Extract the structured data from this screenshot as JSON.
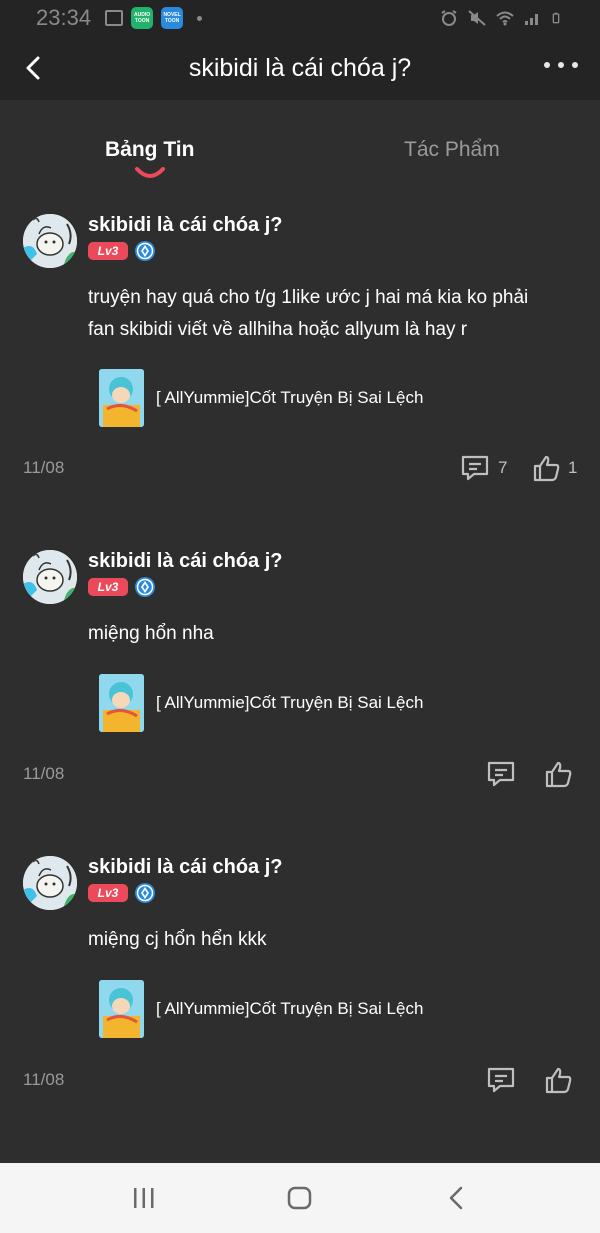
{
  "status_bar": {
    "time": "23:34",
    "app1": "AUDIO TOON",
    "app2": "NOVEL TOON"
  },
  "header": {
    "title": "skibidi là cái chóa j?"
  },
  "tabs": [
    {
      "label": "Bảng Tin",
      "active": true
    },
    {
      "label": "Tác Phẩm",
      "active": false
    }
  ],
  "colors": {
    "accent": "#ec4a5b",
    "background": "#2e2e2e",
    "header_bg": "#242424",
    "verify_blue": "#2a8ae0"
  },
  "posts": [
    {
      "author": "skibidi là cái chóa j?",
      "level": "Lv3",
      "text_lines": [
        "truyện hay quá cho t/g 1like ước j hai má kia ko phải",
        "fan skibidi viết về allhiha hoặc allyum là hay r"
      ],
      "work_title": "[ AllYummie]Cốt Truyện Bị Sai Lệch",
      "date": "11/08",
      "comment_count": "7",
      "like_count": "1"
    },
    {
      "author": "skibidi là cái chóa j?",
      "level": "Lv3",
      "text_lines": [
        "miệng hổn nha"
      ],
      "work_title": "[ AllYummie]Cốt Truyện Bị Sai Lệch",
      "date": "11/08",
      "comment_count": "",
      "like_count": ""
    },
    {
      "author": "skibidi là cái chóa j?",
      "level": "Lv3",
      "text_lines": [
        "miệng cj hổn hển kkk"
      ],
      "work_title": "[ AllYummie]Cốt Truyện Bị Sai Lệch",
      "date": "11/08",
      "comment_count": "",
      "like_count": ""
    }
  ]
}
